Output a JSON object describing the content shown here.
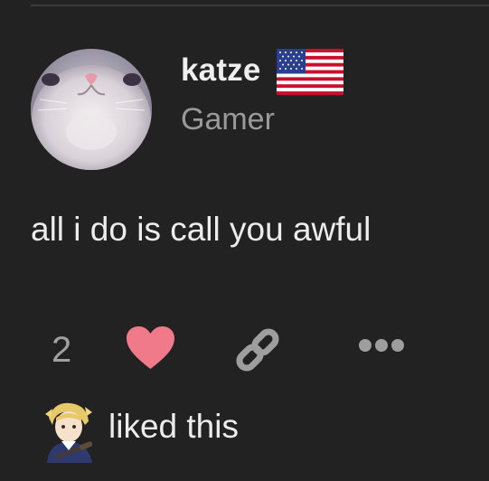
{
  "post": {
    "author": {
      "username": "katze",
      "tagline": "Gamer",
      "avatar_icon": "cat-face-avatar",
      "flag_icon": "us-flag-icon"
    },
    "body": "all i do is call you awful",
    "actions": {
      "like_count": "2",
      "like_icon": "heart-icon",
      "like_color": "#f07a8a",
      "link_icon": "link-icon",
      "more_icon": "more-options-icon"
    },
    "likers": {
      "avatar_icon": "anime-soldier-avatar",
      "text": "liked this"
    }
  },
  "colors": {
    "background": "#222222",
    "primary_text": "#ececec",
    "secondary_text": "#9a9a9a",
    "icon_gray": "#9e9e9e"
  }
}
